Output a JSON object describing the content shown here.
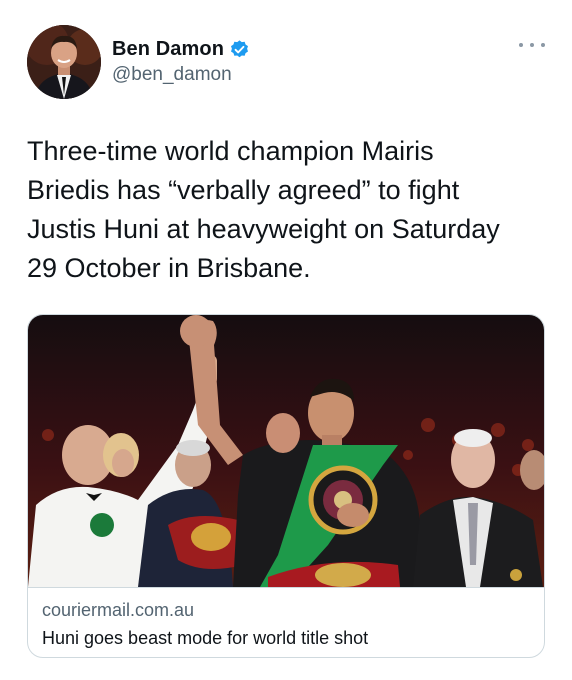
{
  "author": {
    "display_name": "Ben Damon",
    "handle": "@ben_damon",
    "verified": true,
    "avatar_icon": "profile-photo"
  },
  "menu": {
    "icon": "more-horizontal-icon"
  },
  "tweet": {
    "text": "Three-time world champion Mairis\nBriedis has “verbally agreed” to fight\nJustis Huni at heavyweight on Saturday\n29 October in Brisbane."
  },
  "link_card": {
    "image_icon": "boxing-photo",
    "domain": "couriermail.com.au",
    "title": "Huni goes beast mode for world title shot"
  },
  "colors": {
    "text_primary": "#0f1419",
    "text_secondary": "#536471",
    "verified_blue": "#1d9bf0",
    "border": "#cfd9de",
    "belt_green": "#1e9a4a"
  }
}
